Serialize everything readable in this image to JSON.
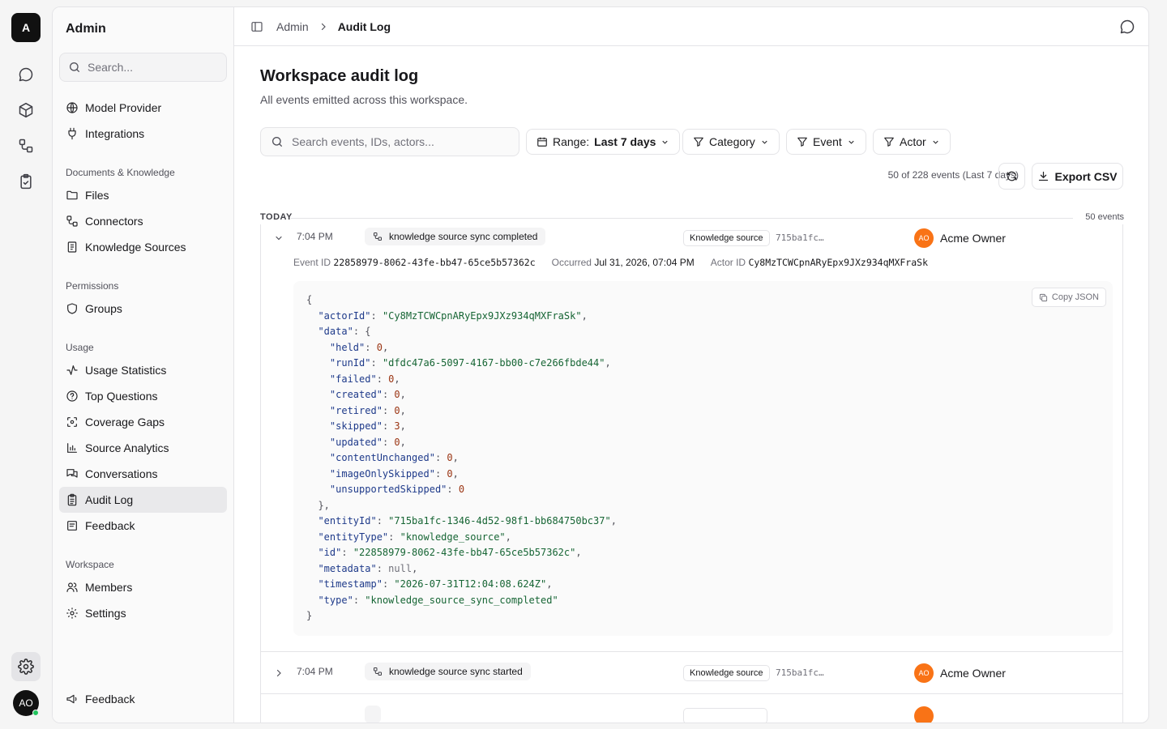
{
  "rail": {
    "logo": "A",
    "avatar": "AO"
  },
  "sidebar": {
    "title": "Admin",
    "search_placeholder": "Search...",
    "top_items": [
      {
        "label": "Model Provider",
        "icon": "globe-icon"
      },
      {
        "label": "Integrations",
        "icon": "plug-icon"
      }
    ],
    "groups": [
      {
        "label": "Documents & Knowledge",
        "items": [
          {
            "label": "Files",
            "icon": "folder-icon"
          },
          {
            "label": "Connectors",
            "icon": "connectors-icon"
          },
          {
            "label": "Knowledge Sources",
            "icon": "book-icon"
          }
        ]
      },
      {
        "label": "Permissions",
        "items": [
          {
            "label": "Groups",
            "icon": "shield-icon"
          }
        ]
      },
      {
        "label": "Usage",
        "items": [
          {
            "label": "Usage Statistics",
            "icon": "activity-icon"
          },
          {
            "label": "Top Questions",
            "icon": "question-icon"
          },
          {
            "label": "Coverage Gaps",
            "icon": "scan-icon"
          },
          {
            "label": "Source Analytics",
            "icon": "bar-chart-icon"
          },
          {
            "label": "Conversations",
            "icon": "chats-icon"
          },
          {
            "label": "Audit Log",
            "icon": "clipboard-icon",
            "active": true
          },
          {
            "label": "Feedback",
            "icon": "message-icon"
          }
        ]
      },
      {
        "label": "Workspace",
        "items": [
          {
            "label": "Members",
            "icon": "users-icon"
          },
          {
            "label": "Settings",
            "icon": "gear-icon"
          }
        ]
      }
    ],
    "footer_feedback": "Feedback"
  },
  "breadcrumb": {
    "parent": "Admin",
    "current": "Audit Log"
  },
  "page": {
    "title": "Workspace audit log",
    "subtitle": "All events emitted across this workspace."
  },
  "filters": {
    "search_placeholder": "Search events, IDs, actors...",
    "range_label": "Range:",
    "range_value": "Last 7 days",
    "category": "Category",
    "event": "Event",
    "actor": "Actor"
  },
  "summary": {
    "count_text": "50 of 228 events (Last 7 days)",
    "export_label": "Export CSV"
  },
  "group_header": {
    "label": "TODAY",
    "count": "50 events"
  },
  "events": [
    {
      "time": "7:04 PM",
      "event": "knowledge source sync completed",
      "category": "Knowledge source",
      "entity_short": "715ba1fc…",
      "actor_initials": "AO",
      "actor": "Acme Owner",
      "expanded": true,
      "details": {
        "event_id_label": "Event ID",
        "event_id": "22858979-8062-43fe-bb47-65ce5b57362c",
        "occurred_label": "Occurred",
        "occurred": "Jul 31, 2026, 07:04 PM",
        "actor_id_label": "Actor ID",
        "actor_id": "Cy8MzTCWCpnARyEpx9JXz934qMXFraSk",
        "copy_label": "Copy JSON"
      }
    },
    {
      "time": "7:04 PM",
      "event": "knowledge source sync started",
      "category": "Knowledge source",
      "entity_short": "715ba1fc…",
      "actor_initials": "AO",
      "actor": "Acme Owner",
      "expanded": false
    }
  ],
  "json_payload": {
    "actorId": "Cy8MzTCWCpnARyEpx9JXz934qMXFraSk",
    "data": {
      "held": 0,
      "runId": "dfdc47a6-5097-4167-bb00-c7e266fbde44",
      "failed": 0,
      "created": 0,
      "retired": 0,
      "skipped": 3,
      "updated": 0,
      "contentUnchanged": 0,
      "imageOnlySkipped": 0,
      "unsupportedSkipped": 0
    },
    "entityId": "715ba1fc-1346-4d52-98f1-bb684750bc37",
    "entityType": "knowledge_source",
    "id": "22858979-8062-43fe-bb47-65ce5b57362c",
    "metadata": null,
    "timestamp": "2026-07-31T12:04:08.624Z",
    "type": "knowledge_source_sync_completed"
  }
}
